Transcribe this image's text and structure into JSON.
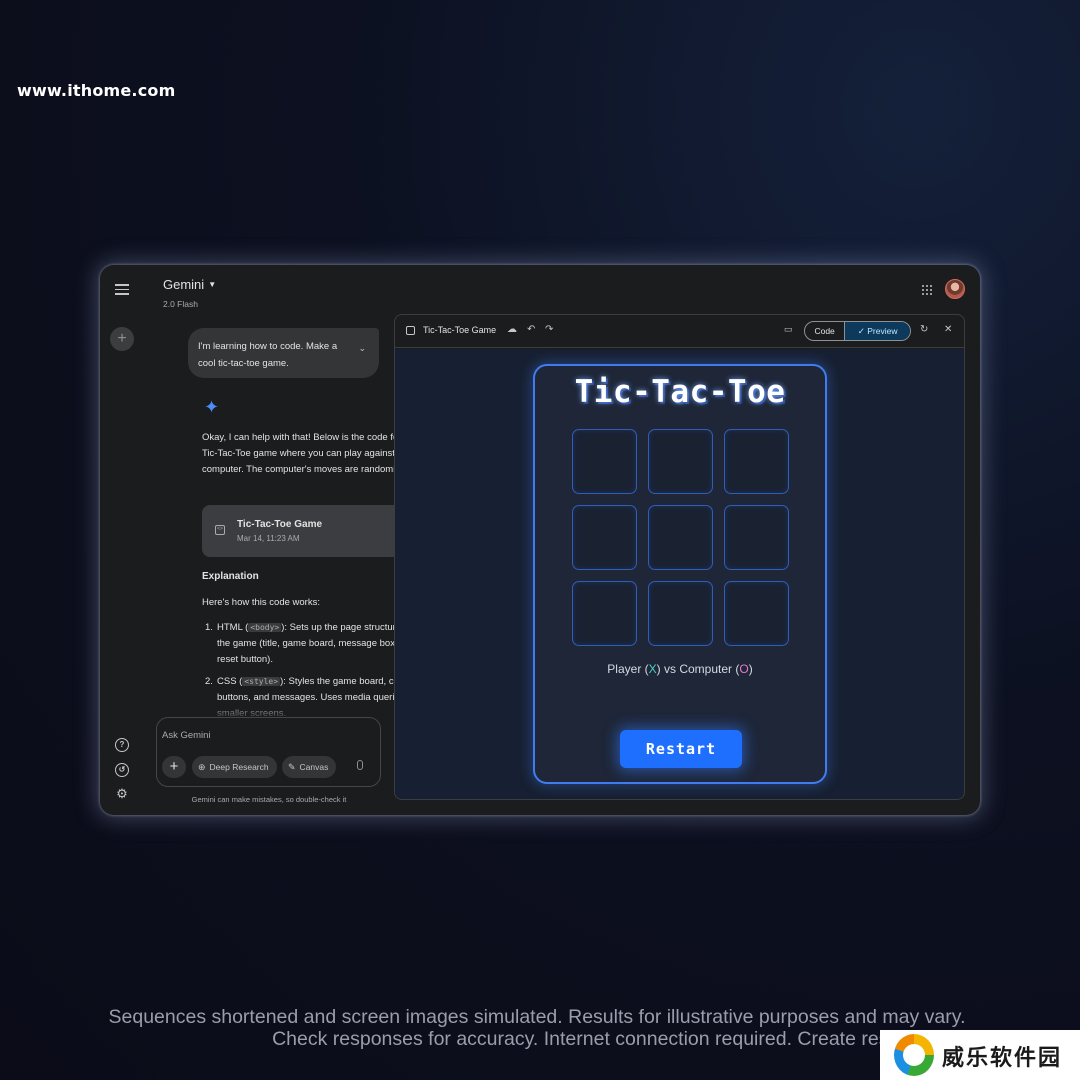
{
  "watermark": {
    "site": "www.ithome.com",
    "logo_text": "威乐软件园"
  },
  "header": {
    "app_name": "Gemini",
    "model": "2.0 Flash"
  },
  "chat": {
    "user_message": "I'm learning how to code. Make a cool tic-tac-toe game.",
    "reply_intro": "Okay, I can help with that! Below is the code for a Tic-Tac-Toe game where you can play against the computer. The computer's moves are randomized.",
    "doc_card": {
      "title": "Tic-Tac-Toe Game",
      "date": "Mar 14, 11:23 AM"
    },
    "explanation_heading": "Explanation",
    "explanation_intro": "Here's how this code works:",
    "items": [
      {
        "num": "1.",
        "pre": "HTML (",
        "code": "<body>",
        "post": "): Sets up the page structure for the game (title, game board, message box, and reset button)."
      },
      {
        "num": "2.",
        "pre": "CSS (",
        "code": "<style>",
        "post": "): Styles the game board, cells, buttons, and messages. Uses media queries for smaller screens."
      }
    ]
  },
  "composer": {
    "placeholder": "Ask Gemini",
    "deep_research": "Deep Research",
    "canvas": "Canvas",
    "disclaimer": "Gemini can make mistakes, so double-check it"
  },
  "canvas": {
    "title": "Tic-Tac-Toe Game",
    "code_label": "Code",
    "preview_label": "Preview",
    "selected_view": "Preview"
  },
  "game": {
    "title": "Tic-Tac-Toe",
    "status_pre": "Player (",
    "player_mark": "X",
    "status_mid": ") vs Computer (",
    "computer_mark": "O",
    "status_post": ")",
    "restart_label": "Restart",
    "cells": [
      "",
      "",
      "",
      "",
      "",
      "",
      "",
      "",
      ""
    ]
  },
  "legal": {
    "line1": "Sequences shortened and screen images simulated. Results for illustrative purposes and may vary.",
    "line2": "Check responses for accuracy. Internet connection required. Create responsib"
  },
  "colors": {
    "accent_blue": "#1f6fff",
    "sparkle": "#4c8df6",
    "player_x": "#4fd1c5",
    "computer_o": "#e879c9"
  }
}
